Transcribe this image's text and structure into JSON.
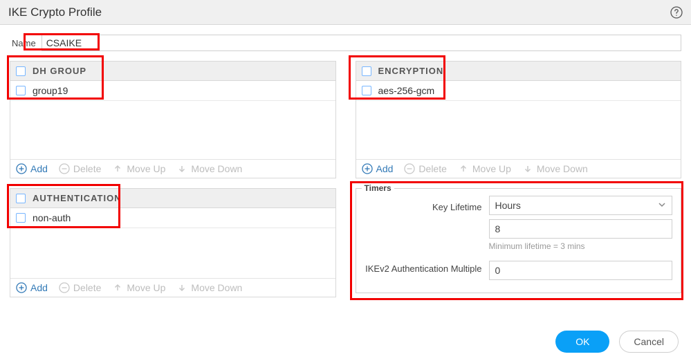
{
  "header": {
    "title": "IKE Crypto Profile"
  },
  "name_field": {
    "label": "Name",
    "value": "CSAIKE"
  },
  "panels": {
    "dh_group": {
      "heading": "DH GROUP",
      "rows": [
        "group19"
      ]
    },
    "encryption": {
      "heading": "ENCRYPTION",
      "rows": [
        "aes-256-gcm"
      ]
    },
    "authentication": {
      "heading": "AUTHENTICATION",
      "rows": [
        "non-auth"
      ]
    }
  },
  "actions": {
    "add_label": "Add",
    "delete_label": "Delete",
    "moveup_label": "Move Up",
    "movedown_label": "Move Down"
  },
  "timers": {
    "legend": "Timers",
    "key_lifetime_label": "Key Lifetime",
    "key_lifetime_unit": "Hours",
    "key_lifetime_value": "8",
    "key_lifetime_hint": "Minimum lifetime = 3 mins",
    "ikev2_auth_mult_label": "IKEv2 Authentication Multiple",
    "ikev2_auth_mult_value": "0"
  },
  "buttons": {
    "ok": "OK",
    "cancel": "Cancel"
  }
}
